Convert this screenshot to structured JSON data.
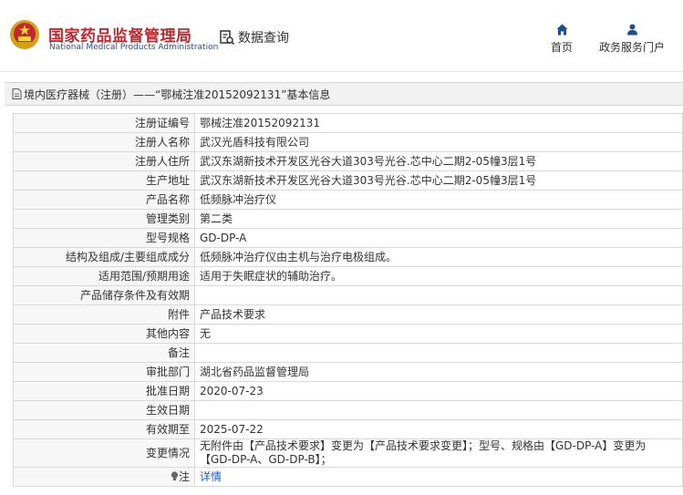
{
  "header": {
    "brand_cn": "国家药品监督管理局",
    "brand_en": "National Medical Products Administration",
    "data_query": "数据查询",
    "nav_home": "首页",
    "nav_service": "政务服务门户",
    "colors": {
      "brand_red": "#c0282d",
      "brand_blue": "#1f4e8c",
      "link_blue": "#1a5ec8"
    },
    "icons": [
      "emblem-icon",
      "search-doc-icon",
      "home-icon",
      "user-icon"
    ]
  },
  "breadcrumb": {
    "text": "境内医疗器械（注册）——“鄂械注准20152092131”基本信息",
    "icon": "document-icon"
  },
  "rows": [
    {
      "label": "注册证编号",
      "value": "鄂械注准20152092131"
    },
    {
      "label": "注册人名称",
      "value": "武汉光盾科技有限公司"
    },
    {
      "label": "注册人住所",
      "value": "武汉东湖新技术开发区光谷大道303号光谷.芯中心二期2-05幢3层1号"
    },
    {
      "label": "生产地址",
      "value": "武汉东湖新技术开发区光谷大道303号光谷.芯中心二期2-05幢3层1号"
    },
    {
      "label": "产品名称",
      "value": "低频脉冲治疗仪"
    },
    {
      "label": "管理类别",
      "value": "第二类"
    },
    {
      "label": "型号规格",
      "value": "GD-DP-A"
    },
    {
      "label": "结构及组成/主要组成成分",
      "value": "低频脉冲治疗仪由主机与治疗电极组成。"
    },
    {
      "label": "适用范围/预期用途",
      "value": "适用于失眠症状的辅助治疗。"
    },
    {
      "label": "产品储存条件及有效期",
      "value": ""
    },
    {
      "label": "附件",
      "value": "产品技术要求"
    },
    {
      "label": "其他内容",
      "value": "无"
    },
    {
      "label": "备注",
      "value": ""
    },
    {
      "label": "审批部门",
      "value": "湖北省药品监督管理局"
    },
    {
      "label": "批准日期",
      "value": "2020-07-23"
    },
    {
      "label": "生效日期",
      "value": ""
    },
    {
      "label": "有效期至",
      "value": "2025-07-22"
    },
    {
      "label": "变更情况",
      "value": "无附件由【产品技术要求】变更为【产品技术要求变更】；型号、规格由【GD-DP-A】变更为【GD-DP-A、GD-DP-B】；"
    },
    {
      "label": "注",
      "value": "详情",
      "icon": "bulb-icon"
    }
  ]
}
